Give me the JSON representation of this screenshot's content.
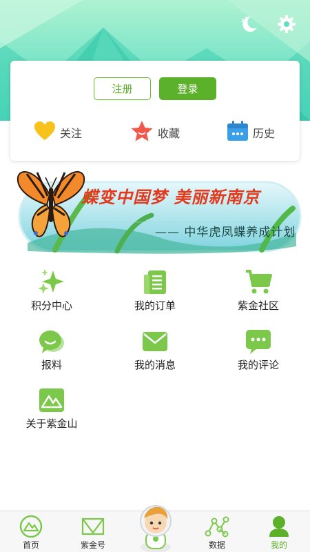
{
  "header": {
    "night_mode_icon": "moon-icon",
    "settings_icon": "gear-icon"
  },
  "account": {
    "register_label": "注册",
    "login_label": "登录",
    "quick_links": [
      {
        "label": "关注",
        "icon": "heart-icon"
      },
      {
        "label": "收藏",
        "icon": "star-icon"
      },
      {
        "label": "历史",
        "icon": "calendar-icon"
      }
    ]
  },
  "banner": {
    "title": "蝶变中国梦  美丽新南京",
    "subtitle": "—— 中华虎凤蝶养成计划"
  },
  "menu": [
    {
      "label": "积分中心",
      "icon": "sparkle-icon"
    },
    {
      "label": "我的订单",
      "icon": "document-icon"
    },
    {
      "label": "紫金社区",
      "icon": "cart-icon"
    },
    {
      "label": "报料",
      "icon": "chat-bubble-icon"
    },
    {
      "label": "我的消息",
      "icon": "envelope-icon"
    },
    {
      "label": "我的评论",
      "icon": "comment-icon"
    },
    {
      "label": "关于紫金山",
      "icon": "mountain-icon"
    }
  ],
  "bottom_nav": [
    {
      "label": "首页",
      "icon": "mountain-circle-icon"
    },
    {
      "label": "紫金号",
      "icon": "folded-icon"
    },
    {
      "label": "数据",
      "icon": "network-icon"
    },
    {
      "label": "我的",
      "icon": "person-icon"
    }
  ],
  "colors": {
    "accent": "#5cb12a",
    "header_teal": "#4fd6bf",
    "banner_red": "#e23a1c"
  }
}
